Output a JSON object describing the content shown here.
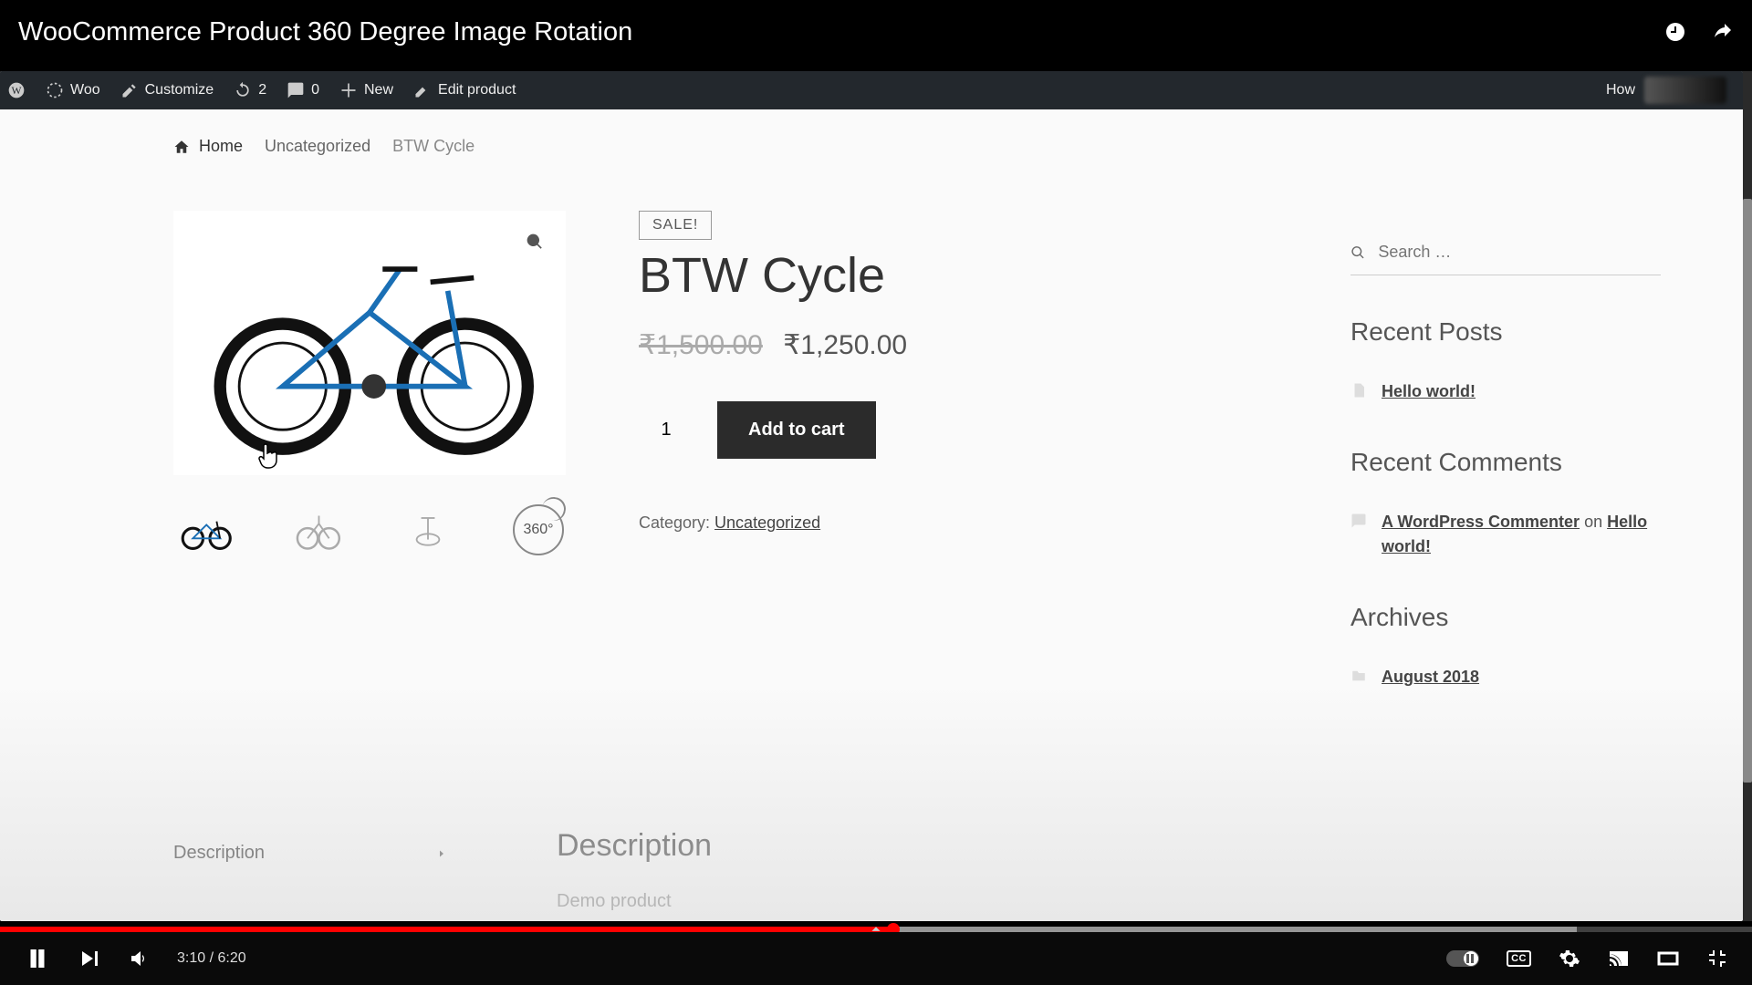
{
  "video": {
    "title": "WooCommerce Product 360 Degree Image Rotation",
    "current_time": "3:10",
    "duration": "6:20",
    "played_pct": 51,
    "cc_label": "CC"
  },
  "wp_admin": {
    "site_name": "Woo",
    "customize": "Customize",
    "updates": "2",
    "comments": "0",
    "new": "New",
    "edit": "Edit product",
    "howdy": "How"
  },
  "breadcrumb": {
    "home": "Home",
    "cat": "Uncategorized",
    "current": "BTW Cycle"
  },
  "product": {
    "sale_badge": "SALE!",
    "title": "BTW Cycle",
    "old_price": "₹1,500.00",
    "new_price": "₹1,250.00",
    "qty": "1",
    "add_to_cart": "Add to cart",
    "category_label": "Category: ",
    "category_link": "Uncategorized",
    "thumb_360_label": "360°"
  },
  "sidebar": {
    "search_placeholder": "Search …",
    "recent_posts_title": "Recent Posts",
    "recent_post_1": "Hello world!",
    "recent_comments_title": "Recent Comments",
    "commenter": "A WordPress Commenter",
    "on": " on ",
    "comment_post": "Hello world!",
    "archives_title": "Archives",
    "archive_1": "August 2018"
  },
  "tabs": {
    "description_tab": "Description",
    "description_heading": "Description",
    "description_text": "Demo product"
  }
}
